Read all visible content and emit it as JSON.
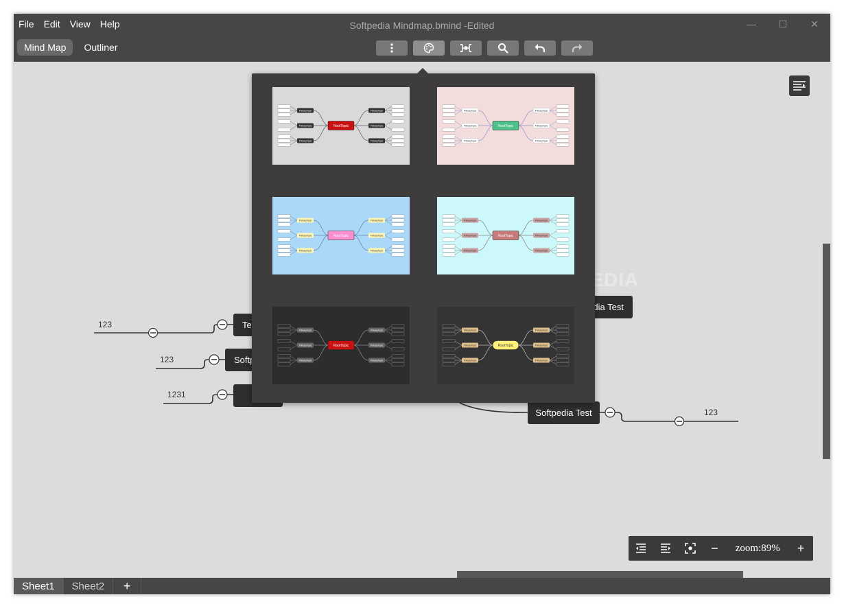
{
  "window": {
    "title": "Softpedia Mindmap.bmind -Edited",
    "minimize": "—",
    "maximize": "☐",
    "close": "✕"
  },
  "menu": [
    "File",
    "Edit",
    "View",
    "Help"
  ],
  "view_tabs": [
    {
      "label": "Mind Map",
      "active": true
    },
    {
      "label": "Outliner",
      "active": false
    }
  ],
  "toolbar": {
    "icons": [
      "more-icon",
      "palette-icon",
      "structure-icon",
      "search-icon",
      "undo-icon",
      "redo-icon"
    ],
    "active": "palette-icon"
  },
  "theme_popup": {
    "themes": [
      {
        "bg": "#d9d9d9",
        "root": "#cc1111",
        "root_label": "RootTopic",
        "branch": "#333333",
        "line": "#666666",
        "primary_label": "PrimaryTopic"
      },
      {
        "bg": "#f2dcdc",
        "root": "#4cc28a",
        "root_label": "RootTopic",
        "branch": "#ffffff",
        "line": "#9999cc",
        "primary_label": "PrimaryTopic"
      },
      {
        "bg": "#aad8f8",
        "root": "#ff8ed0",
        "root_label": "RootTopic",
        "branch": "#fff4b0",
        "line": "#6688aa",
        "primary_label": "PrimaryTopic"
      },
      {
        "bg": "#ccf8fa",
        "root": "#c87a7a",
        "root_label": "RootTopic",
        "branch": "#c9a0a0",
        "line": "#888888",
        "primary_label": "PrimaryTopic"
      },
      {
        "bg": "#2e2d2d",
        "root": "#cc1111",
        "root_label": "RootTopic",
        "branch": "#666666",
        "line": "#888888",
        "primary_label": "PrimaryTopic"
      },
      {
        "bg": "#343434",
        "root": "#fff07a",
        "root_label": "RootTopic",
        "branch": "#e0c08a",
        "line": "#bbbbbb",
        "primary_label": "PrimaryTopic"
      }
    ]
  },
  "mindmap": {
    "nodes": [
      {
        "label": "Te"
      },
      {
        "label": "Softp"
      },
      {
        "label": ""
      },
      {
        "label": "dia Test"
      },
      {
        "label": "Softpedia Test"
      }
    ],
    "leaves": [
      "123",
      "123",
      "1231",
      "123"
    ]
  },
  "watermark": "SOFTPEDIA",
  "zoom": {
    "label": "zoom:89%",
    "minus": "−",
    "plus": "+"
  },
  "sheets": [
    {
      "label": "Sheet1",
      "active": true
    },
    {
      "label": "Sheet2",
      "active": false
    }
  ],
  "sheet_add": "+"
}
